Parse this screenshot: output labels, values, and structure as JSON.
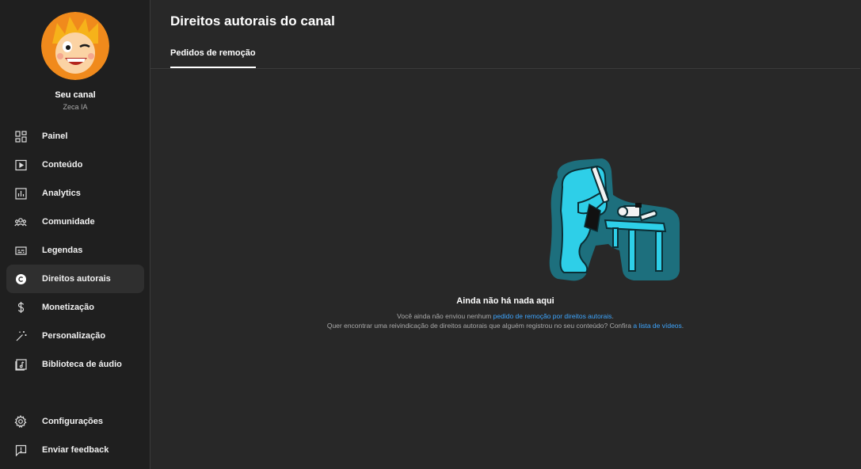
{
  "sidebar": {
    "channel_name": "Seu canal",
    "channel_handle": "Zeca IA",
    "items": [
      {
        "label": "Painel",
        "icon": "dashboard-icon"
      },
      {
        "label": "Conteúdo",
        "icon": "content-icon"
      },
      {
        "label": "Analytics",
        "icon": "analytics-icon"
      },
      {
        "label": "Comunidade",
        "icon": "community-icon"
      },
      {
        "label": "Legendas",
        "icon": "subtitles-icon"
      },
      {
        "label": "Direitos autorais",
        "icon": "copyright-icon",
        "active": true
      },
      {
        "label": "Monetização",
        "icon": "dollar-icon"
      },
      {
        "label": "Personalização",
        "icon": "magic-wand-icon"
      },
      {
        "label": "Biblioteca de áudio",
        "icon": "audio-library-icon"
      }
    ],
    "bottom_items": [
      {
        "label": "Configurações",
        "icon": "gear-icon"
      },
      {
        "label": "Enviar feedback",
        "icon": "feedback-icon"
      }
    ]
  },
  "main": {
    "title": "Direitos autorais do canal",
    "tabs": [
      {
        "label": "Pedidos de remoção",
        "active": true
      }
    ],
    "empty_state": {
      "title": "Ainda não há nada aqui",
      "line1_prefix": "Você ainda não enviou nenhum ",
      "line1_link": "pedido de remoção por direitos autorais",
      "line1_suffix": ".",
      "line2_prefix": "Quer encontrar uma reivindicação de direitos autorais que alguém registrou no seu conteúdo? Confira ",
      "line2_link": "a lista de vídeos",
      "line2_suffix": "."
    }
  },
  "colors": {
    "background": "#282828",
    "sidebar": "#1f1f1f",
    "link": "#3ea6ff",
    "illustration_dark": "#1d6f7d",
    "illustration_light": "#2ecfe8"
  }
}
